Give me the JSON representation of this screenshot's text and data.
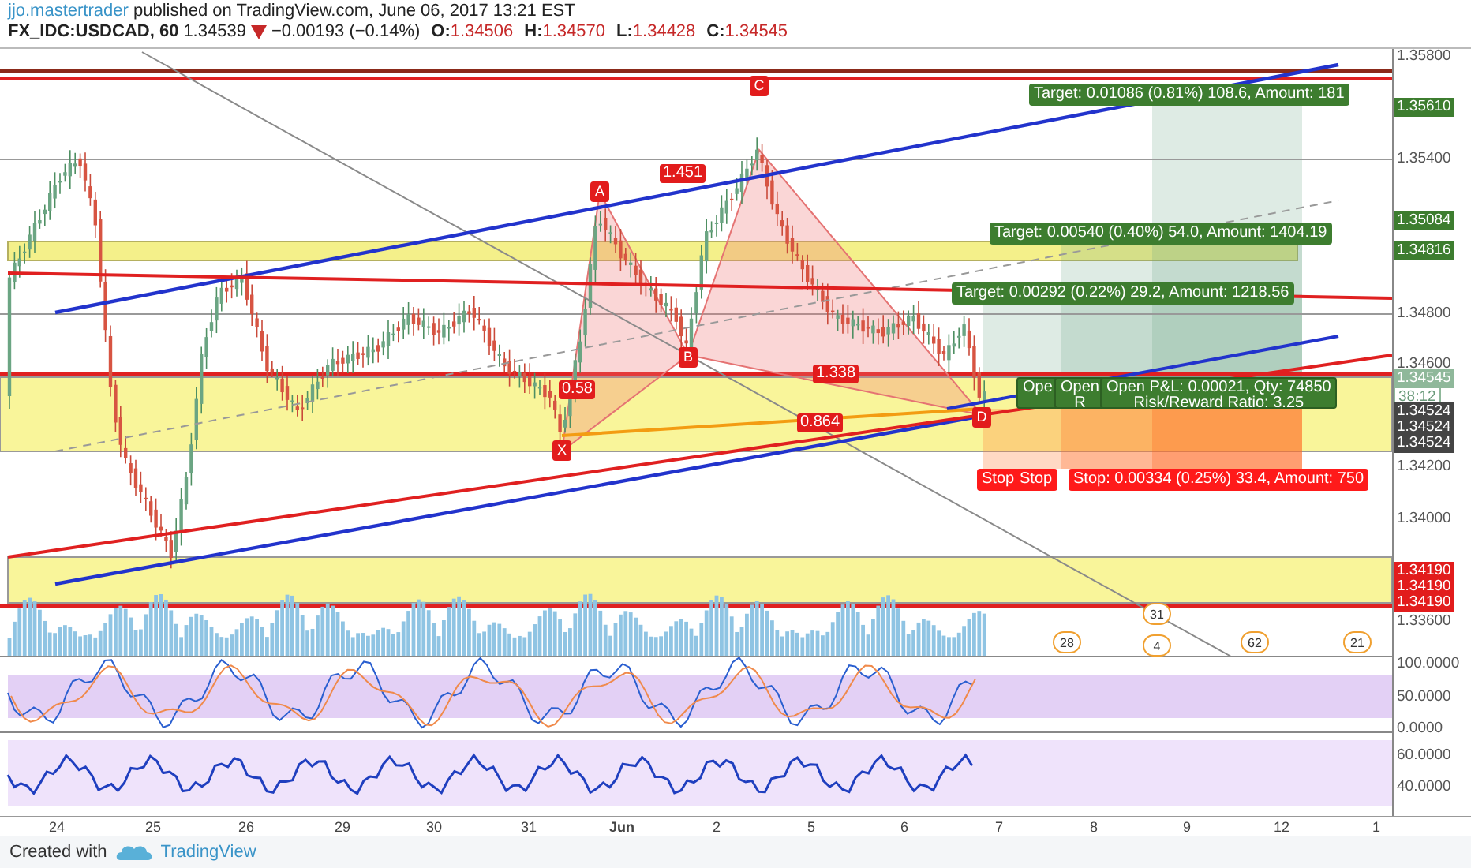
{
  "header": {
    "author": "jjo.mastertrader",
    "published": "published on TradingView.com, June 06, 2017 13:21 EST",
    "symbol": "FX_IDC:USDCAD, 60",
    "last": "1.34539",
    "change": "−0.00193 (−0.14%)",
    "ohlc": [
      {
        "label": "O:",
        "value": "1.34506"
      },
      {
        "label": "H:",
        "value": "1.34570"
      },
      {
        "label": "L:",
        "value": "1.34428"
      },
      {
        "label": "C:",
        "value": "1.34545"
      }
    ]
  },
  "chart": {
    "pattern_points": [
      "X",
      "A",
      "B",
      "C",
      "D"
    ],
    "pattern_ratios": [
      "1.451",
      "0.58",
      "0.864",
      "1.338"
    ],
    "targets": [
      {
        "text": "Target: 0.01086 (0.81%) 108.6, Amount: 181"
      },
      {
        "text": "Target: 0.00540 (0.40%) 54.0, Amount: 1404.19"
      },
      {
        "text": "Target: 0.00292 (0.22%) 29.2, Amount: 1218.56"
      }
    ],
    "open_labels": [
      {
        "lines": [
          "Ope"
        ]
      },
      {
        "lines": [
          "Open",
          "R"
        ]
      },
      {
        "lines": [
          "Open P&L: 0.00021, Qty: 74850",
          "Risk/Reward Ratio: 3.25"
        ]
      }
    ],
    "stops": [
      {
        "text": "Stop"
      },
      {
        "text": "Stop"
      },
      {
        "text": "Stop: 0.00334 (0.25%) 33.4, Amount: 750"
      }
    ],
    "event_flags": [
      "28",
      "31",
      "4",
      "62",
      "21"
    ]
  },
  "price_axis": [
    {
      "text": "1.35800",
      "kind": "plain"
    },
    {
      "text": "1.35610",
      "kind": "green"
    },
    {
      "text": "1.35400",
      "kind": "plain"
    },
    {
      "text": "1.35084",
      "kind": "green"
    },
    {
      "text": "1.34816",
      "kind": "green"
    },
    {
      "text": "1.34800",
      "kind": "plain"
    },
    {
      "text": "1.34600",
      "kind": "plain"
    },
    {
      "text": "1.34545",
      "kind": "last"
    },
    {
      "text": "38:12",
      "kind": "countdown"
    },
    {
      "text": "1.34524",
      "kind": "dark"
    },
    {
      "text": "1.34524",
      "kind": "dark"
    },
    {
      "text": "1.34524",
      "kind": "dark"
    },
    {
      "text": "1.34200",
      "kind": "plain"
    },
    {
      "text": "1.34000",
      "kind": "plain"
    },
    {
      "text": "1.34190",
      "kind": "red"
    },
    {
      "text": "1.34190",
      "kind": "red"
    },
    {
      "text": "1.34190",
      "kind": "red"
    },
    {
      "text": "1.33600",
      "kind": "plain"
    }
  ],
  "stochastic_axis": [
    "100.0000",
    "50.0000",
    "0.0000"
  ],
  "rsi_axis": [
    "60.0000",
    "40.0000"
  ],
  "time_axis": [
    {
      "label": "24",
      "bold": false
    },
    {
      "label": "25",
      "bold": false
    },
    {
      "label": "26",
      "bold": false
    },
    {
      "label": "29",
      "bold": false
    },
    {
      "label": "30",
      "bold": false
    },
    {
      "label": "31",
      "bold": false
    },
    {
      "label": "Jun",
      "bold": true
    },
    {
      "label": "2",
      "bold": false
    },
    {
      "label": "5",
      "bold": false
    },
    {
      "label": "6",
      "bold": false
    },
    {
      "label": "7",
      "bold": false
    },
    {
      "label": "8",
      "bold": false
    },
    {
      "label": "9",
      "bold": false
    },
    {
      "label": "12",
      "bold": false
    },
    {
      "label": "1",
      "bold": false
    }
  ],
  "footer": {
    "created_with": "Created with",
    "brand": "TradingView"
  }
}
